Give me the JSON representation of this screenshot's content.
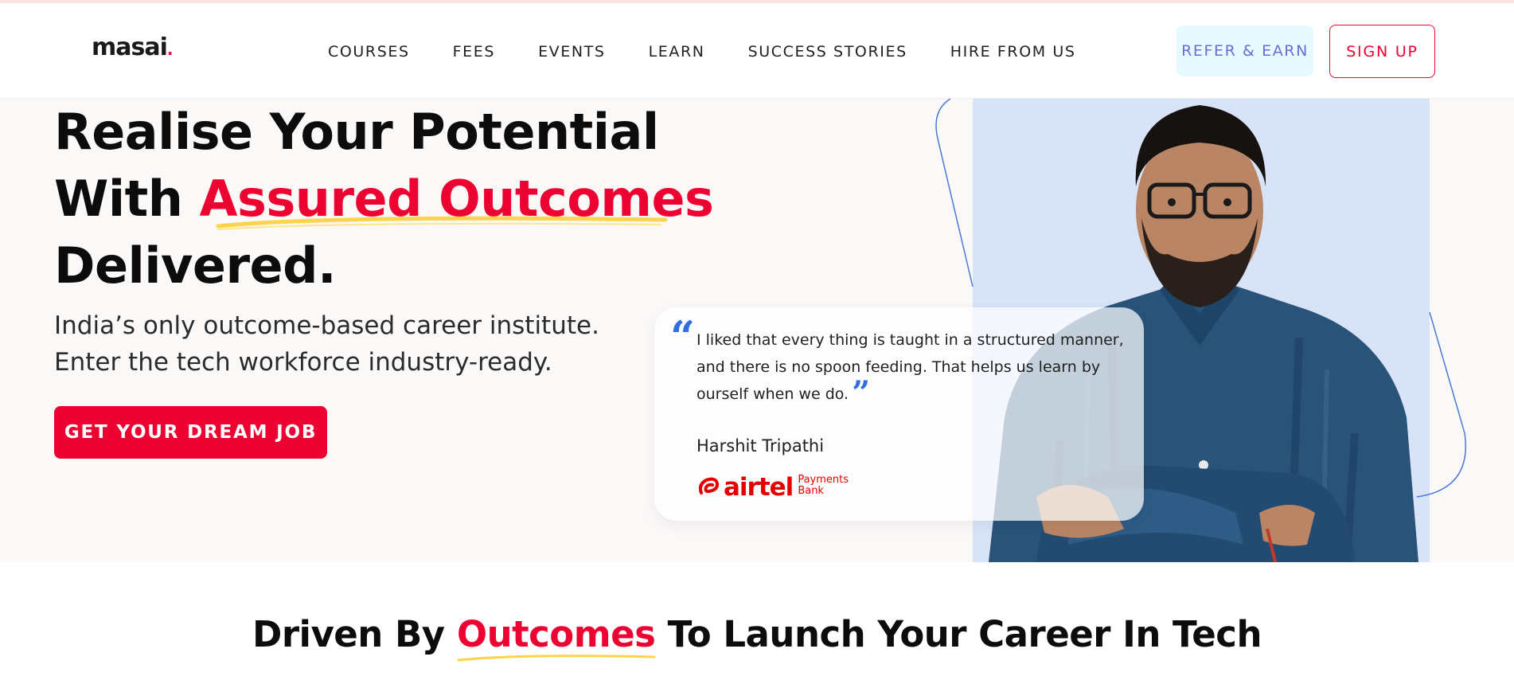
{
  "header": {
    "logo": "masai",
    "nav": [
      "COURSES",
      "FEES",
      "EVENTS",
      "LEARN",
      "SUCCESS STORIES",
      "HIRE FROM US"
    ],
    "refer_label": "REFER & EARN",
    "signup_label": "SIGN UP"
  },
  "hero": {
    "title_line1": "Realise Your Potential",
    "title_line2_prefix": "With ",
    "title_line2_accent": "Assured Outcomes",
    "title_line3": "Delivered.",
    "subtitle_line1": "India’s only outcome-based career institute.",
    "subtitle_line2": "Enter the tech workforce industry-ready.",
    "cta_label": "GET YOUR DREAM JOB"
  },
  "testimonial": {
    "quote": "I liked that every thing is taught in a structured manner, and there is no spoon feeding. That helps us learn by ourself when we do.",
    "author": "Harshit Tripathi",
    "company_name": "airtel",
    "company_sub_line1": "Payments",
    "company_sub_line2": "Bank"
  },
  "section": {
    "heading_prefix": "Driven By ",
    "heading_accent": "Outcomes",
    "heading_suffix": " To Launch Your Career In Tech"
  },
  "colors": {
    "brand_red": "#ed0331",
    "accent_blue": "#2f6fe0",
    "underline_yellow": "#fcd34d",
    "photo_bg": "#d8e3f7"
  }
}
